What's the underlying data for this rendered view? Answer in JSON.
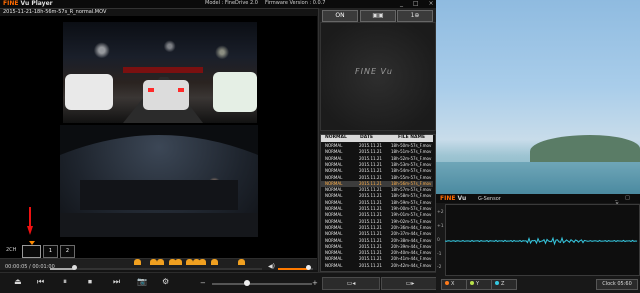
{
  "player": {
    "logo_fine": "FINE",
    "logo_rest": "Vu Player",
    "model": "Model : FineDrive 2.0",
    "firmware": "Firmware Version : 0.0.7",
    "window_controls": "_ □ ×",
    "filename": "2015-11-21-18h-56m-57s_R_normal.MOV"
  },
  "channel": {
    "label": "2CH",
    "btn_1": "1",
    "btn_2": "2"
  },
  "playback": {
    "time": "00:00:05 / 00:01:00",
    "progress_fraction": 0.1,
    "volume_fraction": 0.85,
    "speed_fraction": 0.33
  },
  "toolbar": {
    "eject_icon": "⏏",
    "prev_icon": "⏮",
    "pause_icon": "⏸",
    "stop_icon": "⏹",
    "next_icon": "⏭",
    "camera_icon": "📷",
    "settings_icon": "⚙",
    "minus": "−",
    "plus": "+",
    "prev_file_label": "▭◂",
    "next_file_label": "▭▸"
  },
  "right_panel": {
    "on_label": "ON",
    "capture_label": "▣▣",
    "zoom_label": "1⊕",
    "map_logo": "FINE Vu"
  },
  "file_list": {
    "headers": [
      "NORMAL",
      "DATE",
      "FILE NAME"
    ],
    "rows": [
      {
        "type": "NORMAL",
        "date": "2015.11.21",
        "name": "18h-50m-57s_F.mov"
      },
      {
        "type": "NORMAL",
        "date": "2015.11.21",
        "name": "18h-51m-57s_F.mov"
      },
      {
        "type": "NORMAL",
        "date": "2015.11.21",
        "name": "18h-52m-57s_F.mov"
      },
      {
        "type": "NORMAL",
        "date": "2015.11.21",
        "name": "18h-53m-57s_F.mov"
      },
      {
        "type": "NORMAL",
        "date": "2015.11.21",
        "name": "18h-54m-57s_F.mov"
      },
      {
        "type": "NORMAL",
        "date": "2015.11.21",
        "name": "18h-55m-57s_F.mov"
      },
      {
        "type": "NORMAL",
        "date": "2015.11.21",
        "name": "18h-56m-57s_F.mov",
        "selected": true
      },
      {
        "type": "NORMAL",
        "date": "2015.11.21",
        "name": "18h-57m-57s_F.mov"
      },
      {
        "type": "NORMAL",
        "date": "2015.11.21",
        "name": "18h-58m-57s_F.mov"
      },
      {
        "type": "NORMAL",
        "date": "2015.11.21",
        "name": "18h-59m-57s_F.mov"
      },
      {
        "type": "NORMAL",
        "date": "2015.11.21",
        "name": "19h-00m-57s_F.mov"
      },
      {
        "type": "NORMAL",
        "date": "2015.11.21",
        "name": "19h-01m-57s_F.mov"
      },
      {
        "type": "NORMAL",
        "date": "2015.11.21",
        "name": "19h-02m-57s_F.mov"
      },
      {
        "type": "NORMAL",
        "date": "2015.11.21",
        "name": "20h-36m-44s_F.mov"
      },
      {
        "type": "NORMAL",
        "date": "2015.11.21",
        "name": "20h-37m-44s_F.mov"
      },
      {
        "type": "NORMAL",
        "date": "2015.11.21",
        "name": "20h-38m-44s_F.mov"
      },
      {
        "type": "NORMAL",
        "date": "2015.11.21",
        "name": "20h-39m-44s_F.mov"
      },
      {
        "type": "NORMAL",
        "date": "2015.11.21",
        "name": "20h-40m-44s_F.mov"
      },
      {
        "type": "NORMAL",
        "date": "2015.11.21",
        "name": "20h-41m-44s_F.mov"
      },
      {
        "type": "NORMAL",
        "date": "2015.11.21",
        "name": "20h-42m-44s_F.mov"
      }
    ]
  },
  "gsensor": {
    "logo_fine": "FINE",
    "logo_rest": "Vu",
    "title": "G-Sensor",
    "window_controls": "_ □ ×",
    "y_ticks": [
      "+2",
      "+1",
      "0",
      "-1",
      "-2"
    ],
    "axes": [
      {
        "label": "X",
        "color": "#ff7a1a"
      },
      {
        "label": "Y",
        "color": "#b8e04a"
      },
      {
        "label": "Z",
        "color": "#35c8e0"
      }
    ],
    "clock_label": "Clock 05:60"
  },
  "colors": {
    "accent": "#ff7a00",
    "selected_row": "#ffb04a",
    "signal": "#35c8e0"
  }
}
